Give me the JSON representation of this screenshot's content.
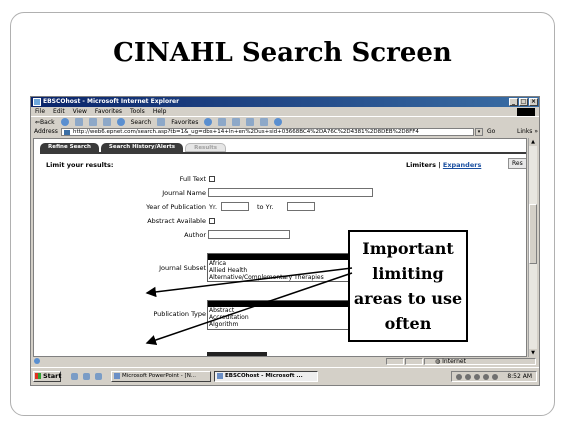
{
  "slide": {
    "title": "CINAHL Search Screen"
  },
  "browser": {
    "window_title": "EBSCOhost - Microsoft Internet Explorer",
    "window_buttons": [
      "_",
      "□",
      "×"
    ],
    "menu": [
      "File",
      "Edit",
      "View",
      "Favorites",
      "Tools",
      "Help"
    ],
    "toolbar": {
      "back": "⇐Back",
      "search": "Search",
      "favorites": "Favorites"
    },
    "address_label": "Address",
    "address_url": "http://web6.epnet.com/search.asp?tb=1&_ug=dbs+14+ln+en%2Dus+sid+03668BC4%2DA76C%2D4381%2D8DEB%2D8FF4",
    "go_label": "Go",
    "links_label": "Links »"
  },
  "page": {
    "tabs": [
      "Refine Search",
      "Search History/Alerts",
      "Results"
    ],
    "limit_heading": "Limit your results:",
    "limiters_label": "Limiters",
    "separator": "|",
    "expanders_label": "Expanders",
    "reset_label": "Res",
    "fields": {
      "full_text": "Full Text",
      "journal_name": "Journal Name",
      "year_of_publication": "Year of Publication",
      "yr_from": "Yr.",
      "yr_to": "to Yr.",
      "abstract_available": "Abstract Available",
      "author": "Author",
      "journal_subset": "Journal Subset",
      "publication_type": "Publication Type"
    },
    "journal_subset_options": [
      "Africa",
      "Allied Health",
      "Alternative/Complementary Therapies"
    ],
    "publication_type_options": [
      "Abstract",
      "Accreditation",
      "Algorithm"
    ]
  },
  "statusbar": {
    "zone": "Internet"
  },
  "taskbar": {
    "start": "Start",
    "tasks": [
      "Microsoft PowerPoint - [N...",
      "EBSCOhost - Microsoft ..."
    ],
    "clock": "8:52 AM"
  },
  "callout": {
    "lines": [
      "Important",
      "limiting",
      "areas to use",
      "often"
    ]
  }
}
